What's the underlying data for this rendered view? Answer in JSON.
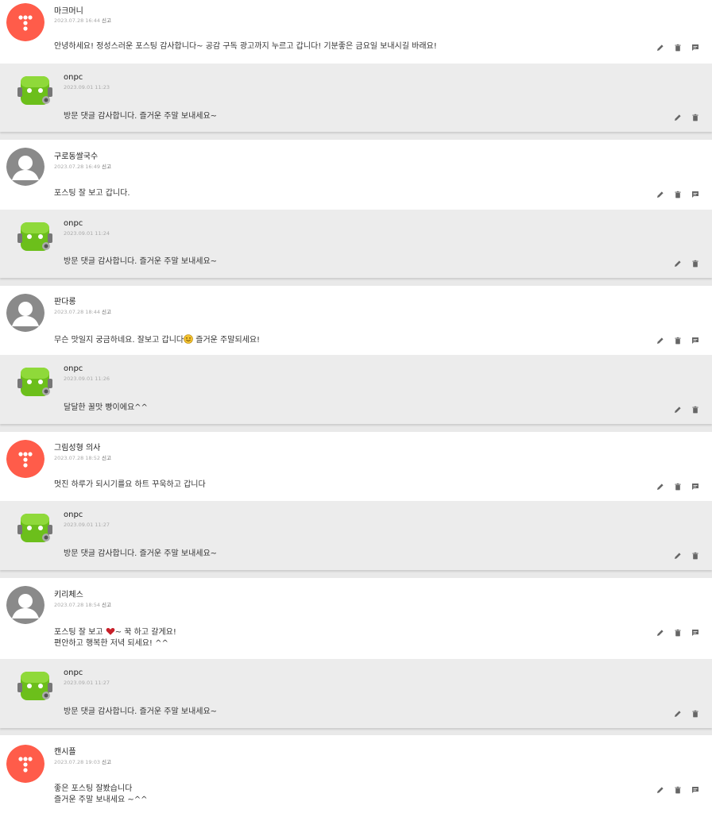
{
  "report_label": "신고",
  "colors": {
    "reply_bg": "#ececec",
    "parent_bg": "#ffffff",
    "tmap_avatar": "#ff5c4a",
    "default_avatar": "#8a8a8a",
    "reply_avatar": "#6cbf1b"
  },
  "threads": [
    {
      "comment": {
        "name": "마크머니",
        "date": "2023.07.28 16:44",
        "avatar_icon": "tmap-logo-avatar",
        "lines": [
          "안녕하세요! 정성스러운 포스팅 감사합니다~ 공감 구독 광고까지 누르고 갑니다! 기분좋은 금요일 보내시길 바래요!"
        ]
      },
      "reply": {
        "name": "onpc",
        "date": "2023.09.01 11:23",
        "lines": [
          "방문 댓글 감사합니다. 즐거운 주말 보내세요~"
        ]
      }
    },
    {
      "comment": {
        "name": "구로동쌀국수",
        "date": "2023.07.28 16:49",
        "avatar_icon": "default-user-avatar",
        "lines": [
          "포스팅 잘 보고 갑니다."
        ]
      },
      "reply": {
        "name": "onpc",
        "date": "2023.09.01 11:24",
        "lines": [
          "방문 댓글 감사합니다. 즐거운 주말 보내세요~"
        ]
      }
    },
    {
      "comment": {
        "name": "판다롱",
        "date": "2023.07.28 18:44",
        "avatar_icon": "default-user-avatar",
        "lines": [
          "무슨 맛일지 궁금하네요. 잘보고 갑니다",
          " 즐거운 주말되세요!"
        ],
        "inline_emoji": "smile-emoji-icon"
      },
      "reply": {
        "name": "onpc",
        "date": "2023.09.01 11:26",
        "lines": [
          "달달한 꿀맛 빵이에요^^"
        ]
      }
    },
    {
      "comment": {
        "name": "그림성형 의사",
        "date": "2023.07.28 18:52",
        "avatar_icon": "tmap-logo-avatar",
        "lines": [
          "멋진 하루가 되시기를요 하트 꾸욱하고 갑니다"
        ]
      },
      "reply": {
        "name": "onpc",
        "date": "2023.09.01 11:27",
        "lines": [
          "방문 댓글 감사합니다. 즐거운 주말 보내세요~"
        ]
      }
    },
    {
      "comment": {
        "name": "키리체스",
        "date": "2023.07.28 18:54",
        "avatar_icon": "default-user-avatar",
        "lines": [
          "포스팅 잘 보고 ",
          "~ 꾹 하고 갈게요!",
          "편안하고 행복한 저녁 되세요! ^^"
        ],
        "inline_emoji": "heart-emoji-icon"
      },
      "reply": {
        "name": "onpc",
        "date": "2023.09.01 11:27",
        "lines": [
          "방문 댓글 감사합니다. 즐거운 주말 보내세요~"
        ]
      }
    },
    {
      "comment": {
        "name": "캔시플",
        "date": "2023.07.28 19:03",
        "avatar_icon": "tmap-logo-avatar",
        "lines": [
          "좋은 포스팅 잘봤습니다",
          "즐거운 주말 보내세요 ~^^"
        ]
      }
    }
  ]
}
